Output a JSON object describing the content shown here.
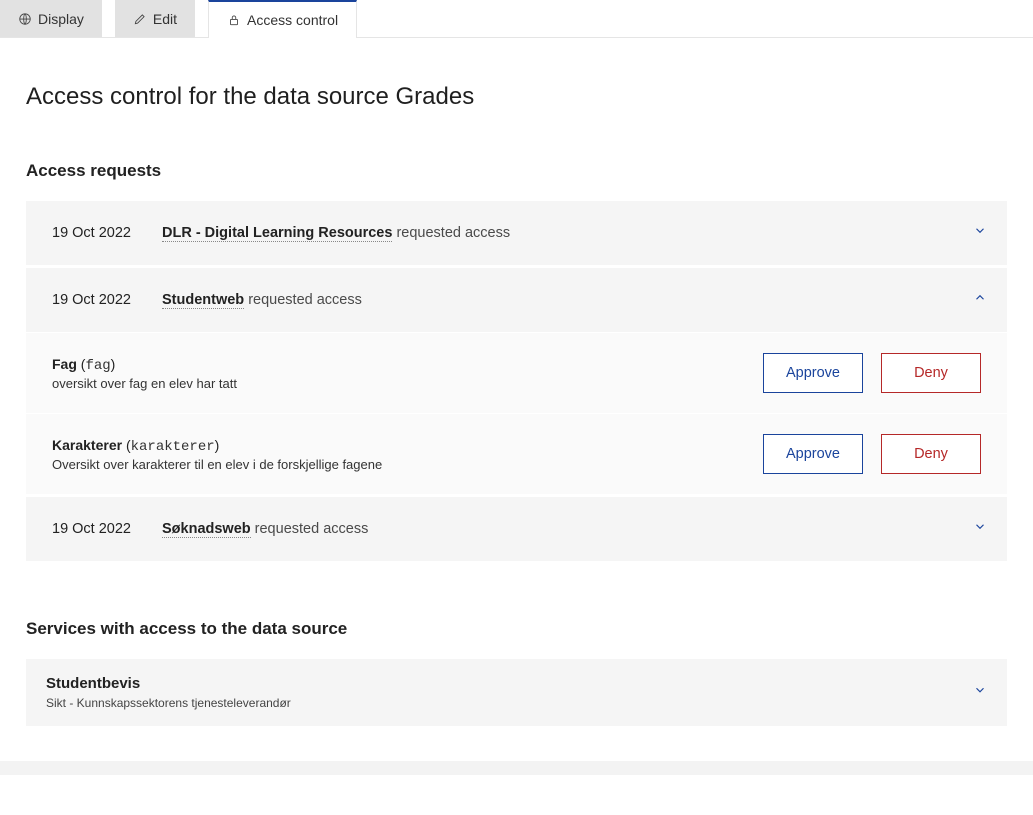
{
  "tabs": {
    "display": "Display",
    "edit": "Edit",
    "access_control": "Access control"
  },
  "page_title": "Access control for the data source Grades",
  "requests_section_title": "Access requests",
  "requested_access_suffix": " requested access",
  "requests": [
    {
      "date": "19 Oct 2022",
      "app": "DLR - Digital Learning Resources",
      "expanded": false
    },
    {
      "date": "19 Oct 2022",
      "app": "Studentweb",
      "expanded": true,
      "items": [
        {
          "name": "Fag",
          "code": "fag",
          "desc": "oversikt over fag en elev har tatt"
        },
        {
          "name": "Karakterer",
          "code": "karakterer",
          "desc": "Oversikt over karakterer til en elev i de forskjellige fagene"
        }
      ]
    },
    {
      "date": "19 Oct 2022",
      "app": "Søknadsweb",
      "expanded": false
    }
  ],
  "buttons": {
    "approve": "Approve",
    "deny": "Deny"
  },
  "services_section_title": "Services with access to the data source",
  "services": [
    {
      "name": "Studentbevis",
      "provider": "Sikt - Kunnskapssektorens tjenesteleverandør"
    }
  ]
}
